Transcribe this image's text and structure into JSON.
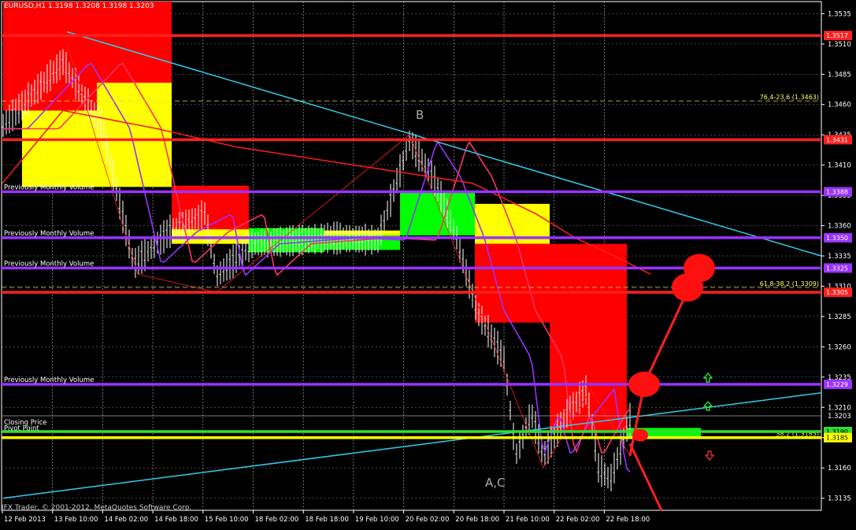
{
  "chart_data": {
    "type": "candlestick",
    "header": "EURUSD,H1  1.3198 1.3208 1.3198 1.3203",
    "copyright": "IFX Trader, © 2001-2012, MetaQuotes Software Corp.",
    "ylim": [
      1.3125,
      1.3545
    ],
    "price_ticks": [
      "1.3535",
      "1.3510",
      "1.3485",
      "1.3460",
      "1.3435",
      "1.3410",
      "1.3385",
      "1.3360",
      "1.3335",
      "1.3310",
      "1.3285",
      "1.3260",
      "1.3235",
      "1.3210",
      "1.3185",
      "1.3160",
      "1.3135"
    ],
    "time_labels": [
      "12 Feb 2013",
      "13 Feb 10:00",
      "14 Feb 02:00",
      "14 Feb 18:00",
      "15 Feb 10:00",
      "18 Feb 02:00",
      "18 Feb 18:00",
      "19 Feb 10:00",
      "20 Feb 02:00",
      "20 Feb 18:00",
      "21 Feb 10:00",
      "22 Feb 02:00",
      "22 Feb 18:00"
    ],
    "current_price": {
      "price": 1.3203,
      "label": "1.3203"
    },
    "levels": [
      {
        "price": 1.3517,
        "label": "1.3517",
        "color": "#ff2020"
      },
      {
        "price": 1.3431,
        "label": "1.3431",
        "color": "#ff2020"
      },
      {
        "price": 1.3388,
        "label": "1.3388",
        "color": "#9933ff"
      },
      {
        "price": 1.335,
        "label": "1.3350",
        "color": "#9933ff"
      },
      {
        "price": 1.3325,
        "label": "1.3325",
        "color": "#9933ff"
      },
      {
        "price": 1.3305,
        "label": "1.3305",
        "color": "#ff2020"
      },
      {
        "price": 1.3229,
        "label": "1.3229",
        "color": "#9933ff"
      },
      {
        "price": 1.319,
        "label": "1.3190",
        "color": "#33dd33"
      },
      {
        "price": 1.3185,
        "label": "1.3185",
        "color": "#ffff00"
      }
    ],
    "fib_levels": [
      {
        "price": 1.3463,
        "label": "76,4-23,6 (1.3463)"
      },
      {
        "price": 1.3309,
        "label": "61,8-38,2 (1.3309)"
      },
      {
        "price": 1.3185,
        "label": "38,2 (1.3185)"
      }
    ],
    "line_labels": [
      {
        "price": 1.3388,
        "text": "Previously Monthly Volume"
      },
      {
        "price": 1.335,
        "text": "Previously Monthly Volume"
      },
      {
        "price": 1.3325,
        "text": "Previously Monthly Volume"
      },
      {
        "price": 1.3229,
        "text": "Previously Monthly Volume"
      },
      {
        "price": 1.3194,
        "text": "Closing Price"
      },
      {
        "price": 1.3189,
        "text": "Pivot Point"
      }
    ],
    "annotations": [
      "B",
      "A,C"
    ],
    "colors": {
      "red": "#ff0000",
      "yellow": "#ffff00",
      "green": "#00ff00",
      "purple": "#9933ff",
      "cyan": "#33ccee",
      "bg": "#000000"
    }
  }
}
